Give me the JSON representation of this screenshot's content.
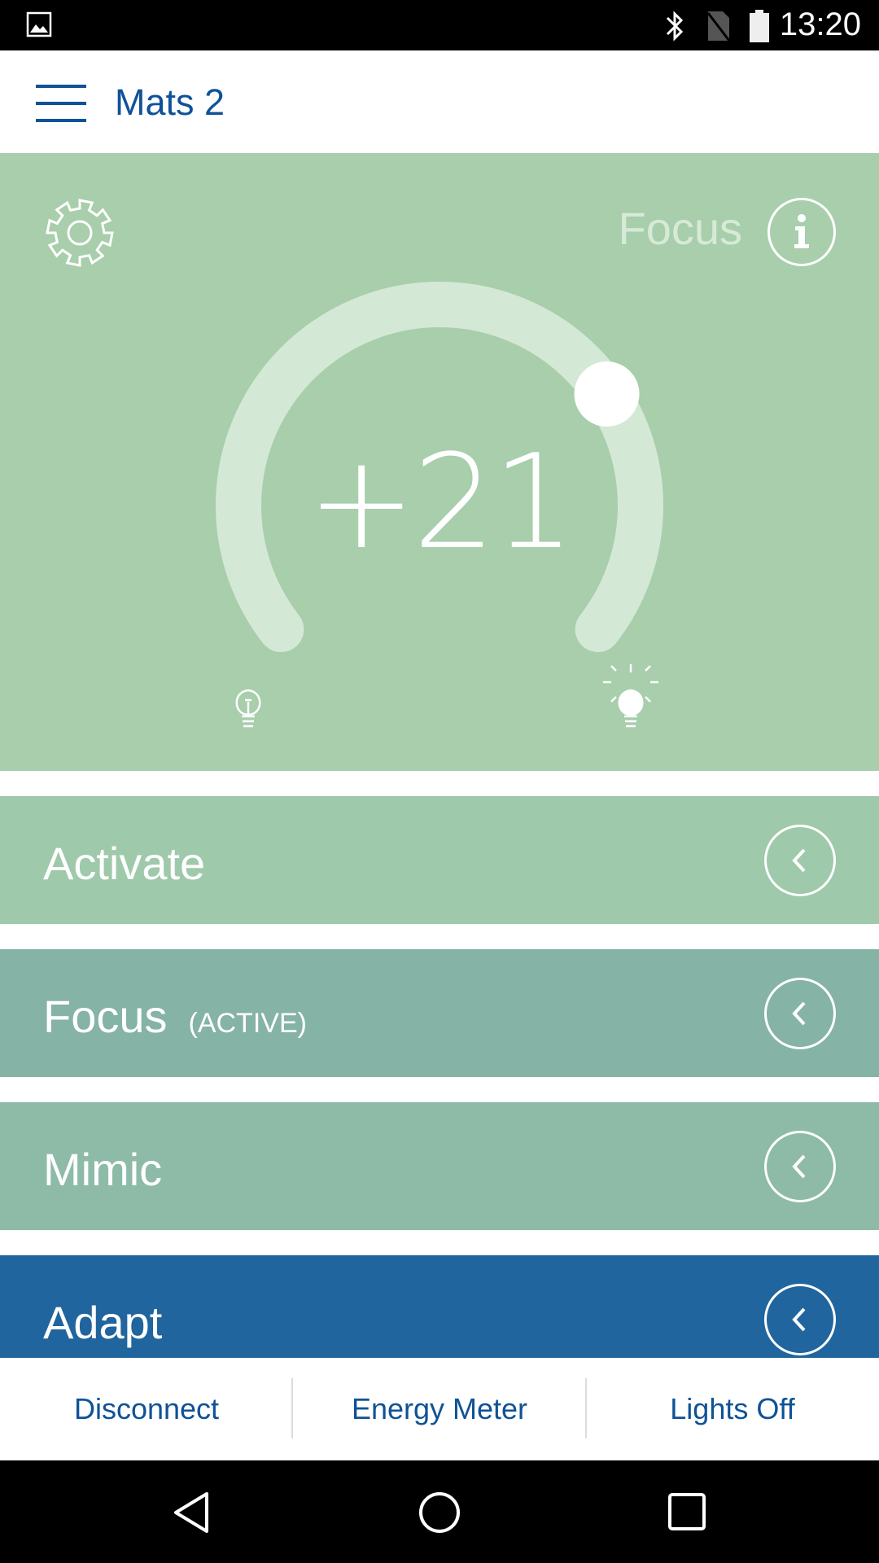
{
  "status_bar": {
    "time": "13:20",
    "icons": [
      "image-notification-icon",
      "bluetooth-icon",
      "no-sim-icon",
      "battery-icon"
    ]
  },
  "app_bar": {
    "title": "Mats 2",
    "menu_icon": "hamburger-menu-icon"
  },
  "dial_panel": {
    "mode_label": "Focus",
    "value_text": "+21",
    "dial_fraction": 0.72,
    "settings_icon": "gear-icon",
    "info_icon": "info-icon",
    "min_icon": "bulb-off-icon",
    "max_icon": "bulb-on-icon",
    "background_color": "#a8ceac"
  },
  "modes": [
    {
      "label": "Activate",
      "sublabel": "",
      "color": "#9ec9aa"
    },
    {
      "label": "Focus",
      "sublabel": "(ACTIVE)",
      "color": "#85b3a6"
    },
    {
      "label": "Mimic",
      "sublabel": "",
      "color": "#8dbba8"
    },
    {
      "label": "Adapt",
      "sublabel": "",
      "color": "#20659d"
    }
  ],
  "bottom_bar": {
    "disconnect": "Disconnect",
    "energy_meter": "Energy Meter",
    "lights_off": "Lights Off"
  },
  "colors": {
    "brand_blue": "#0f5297"
  }
}
